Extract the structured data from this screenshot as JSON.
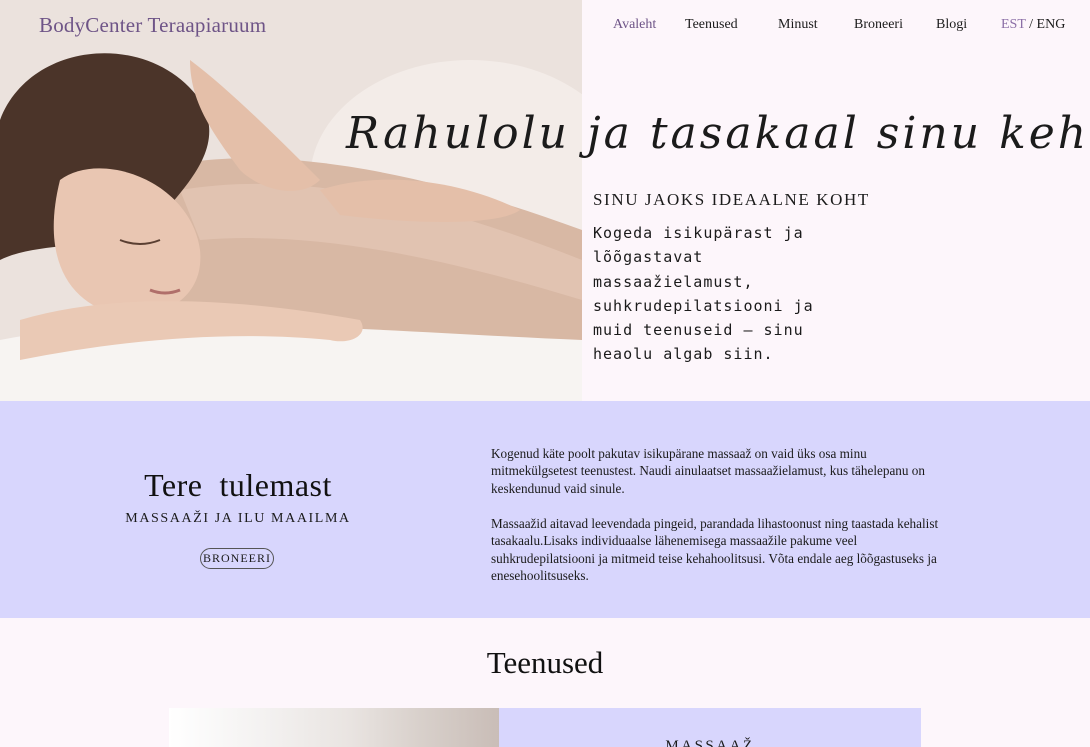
{
  "header": {
    "brand": "BodyCenter Teraapiaruum",
    "nav": [
      {
        "label": "Avaleht",
        "active": true
      },
      {
        "label": "Teenused",
        "active": false
      },
      {
        "label": "Minust",
        "active": false
      },
      {
        "label": "Broneeri",
        "active": false
      },
      {
        "label": "Blogi",
        "active": false
      }
    ],
    "lang": {
      "est": "EST",
      "separator": " / ",
      "eng": "ENG"
    }
  },
  "hero": {
    "tagline": "Rahulolu ja tasakaal sinu kehas",
    "subheading": "SINU JAOKS IDEAALNE KOHT",
    "text": "Kogeda isikupärast ja lõõgastavat massaažielamust, suhkrudepilatsiooni ja muid teenuseid – sinu heaolu algab siin."
  },
  "welcome": {
    "title": "Tere  tulemast",
    "subtitle": "MASSAAŽI JA ILU MAAILMA",
    "button": "BRONEERI",
    "paragraphs": [
      "Kogenud käte poolt pakutav isikupärane massaaž on vaid üks osa minu mitmekülgsetest teenustest. Naudi ainulaatset massaažielamust, kus tähelepanu on keskendunud vaid sinule.",
      "Massaažid aitavad leevendada pingeid, parandada lihastoonust ning taastada kehalist tasakaalu.Lisaks individuaalse lähenemisega massaažile pakume veel suhkrudepilatsiooni ja mitmeid teise kehahoolitsusi. Võta endale aeg lõõgastuseks ja enesehoolitsuseks."
    ]
  },
  "services": {
    "title": "Teenused",
    "cards": [
      {
        "name": "MASSAAŽ"
      }
    ]
  },
  "colors": {
    "accent": "#6e5487",
    "panel": "#d8d6fd",
    "background": "#fdf6fb"
  }
}
